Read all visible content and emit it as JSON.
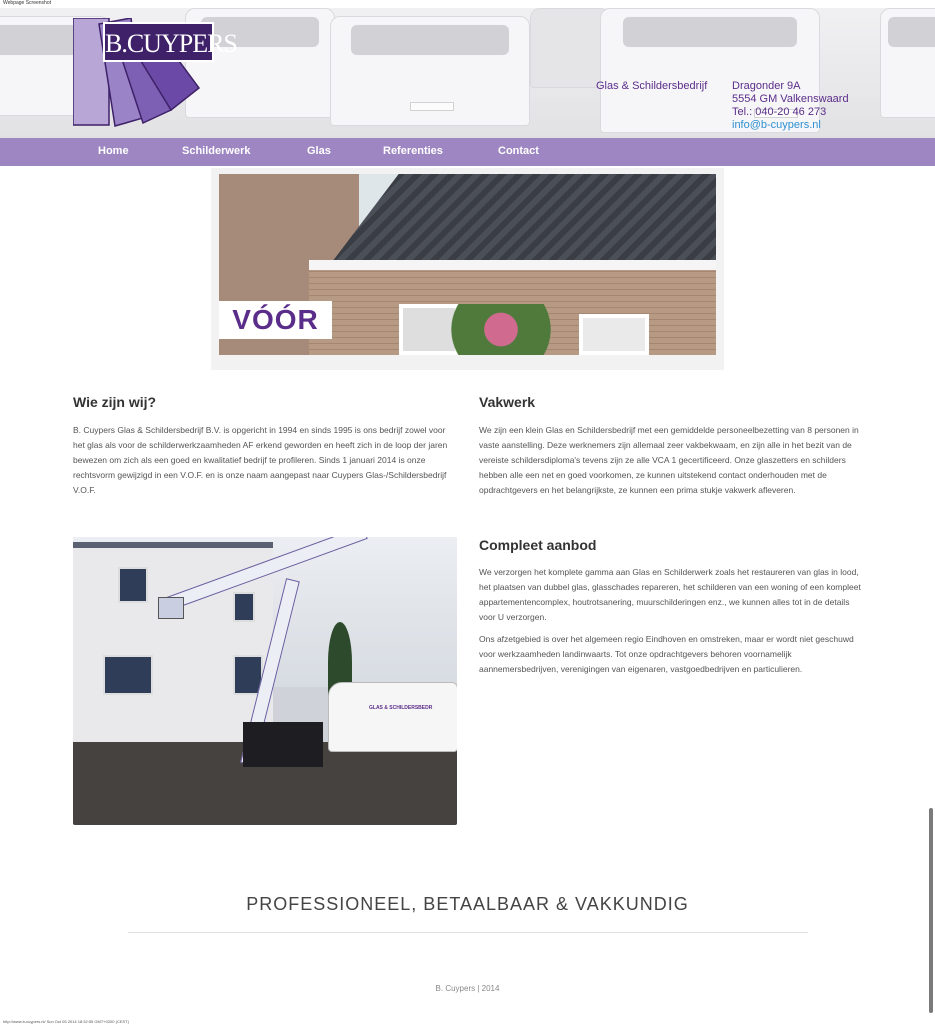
{
  "capture": {
    "title": "Webpage Screenshot",
    "footer": "http://www.b-cuypers.nl/ Sun Oct 05 2014 18:32:55 GMT+0200 (CEST)"
  },
  "header": {
    "logo_text": "B.CUYPERS",
    "tagline": "Glas & Schildersbedrijf",
    "address": {
      "street": "Dragonder 9A",
      "city": "5554 GM Valkenswaard",
      "phone": "Tel.: 040-20 46 273",
      "email": "info@b-cuypers.nl"
    }
  },
  "nav": {
    "items": [
      {
        "label": "Home"
      },
      {
        "label": "Schilderwerk"
      },
      {
        "label": "Glas"
      },
      {
        "label": "Referenties"
      },
      {
        "label": "Contact"
      }
    ]
  },
  "slider": {
    "label": "VÓÓR"
  },
  "sections": {
    "about": {
      "heading": "Wie zijn wij?",
      "text": "B. Cuypers Glas & Schildersbedrijf B.V. is opgericht in 1994 en sinds 1995 is ons bedrijf zowel voor het glas als voor de schilderwerkzaamheden AF erkend geworden en heeft zich in de loop der jaren bewezen om zich als een goed en kwalitatief bedrijf te profileren. Sinds 1 januari 2014 is onze rechtsvorm gewijzigd in een V.O.F. en is onze naam aangepast naar Cuypers Glas-/Schildersbedrijf V.O.F."
    },
    "craft": {
      "heading": "Vakwerk",
      "text": "We zijn een klein Glas en Schildersbedrijf met een gemiddelde personeelbezetting van 8 personen in vaste aanstelling. Deze werknemers zijn allemaal zeer vakbekwaam, en zijn alle in het bezit van de vereiste schildersdiploma's tevens zijn ze alle VCA 1 gecertificeerd. Onze glaszetters en schilders hebben alle een net en goed voorkomen, ze kunnen uitstekend contact onderhouden met de opdrachtgevers en het belangrijkste, ze kunnen een prima stukje vakwerk afleveren."
    },
    "offer": {
      "heading": "Compleet aanbod",
      "text1": "We verzorgen het komplete gamma aan Glas en Schilderwerk zoals het restaureren van glas in lood, het plaatsen van dubbel glas, glasschades repareren, het schilderen van een woning of een kompleet appartementencomplex, houtrotsanering, muurschilderingen enz., we kunnen alles tot in de details voor U verzorgen.",
      "text2": "Ons afzetgebied is over het algemeen regio Eindhoven en omstreken, maar er wordt niet geschuwd voor werkzaamheden landinwaarts. Tot onze opdrachtgevers behoren voornamelijk aannemersbedrijven, verenigingen van eigenaren, vastgoedbedrijven en particulieren."
    }
  },
  "photo": {
    "van_text": "GLAS & SCHILDERSBEDR"
  },
  "footer": {
    "slogan": "PROFESSIONEEL, BETAALBAAR & VAKKUNDIG",
    "copyright": "B. Cuypers | 2014"
  },
  "colors": {
    "brand_purple": "#5b2d8a",
    "nav_bg": "#9d86c2",
    "logo_dark": "#3e2168",
    "link_blue": "#2f8fd1"
  }
}
